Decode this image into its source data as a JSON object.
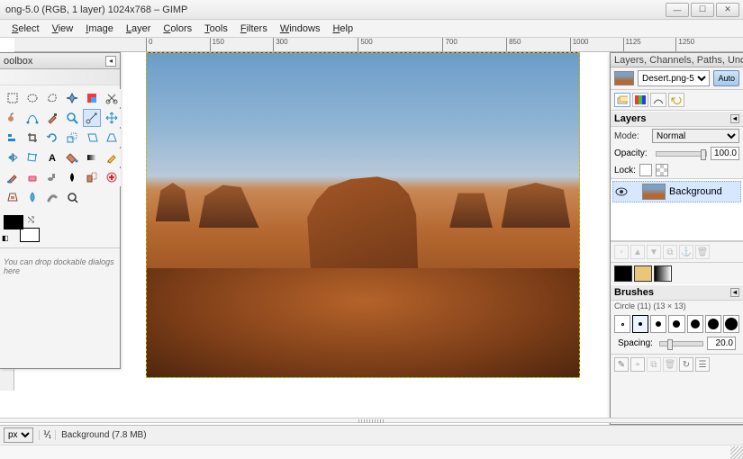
{
  "title": "ong-5.0 (RGB, 1 layer) 1024x768 – GIMP",
  "menu": [
    "Select",
    "View",
    "Image",
    "Layer",
    "Colors",
    "Tools",
    "Filters",
    "Windows",
    "Help"
  ],
  "ruler_ticks": [
    0,
    150,
    300,
    500,
    700,
    850,
    1000,
    1125,
    1250
  ],
  "toolbox": {
    "title": "oolbox",
    "drop_hint": "You can drop dockable dialogs here",
    "tools": [
      "rect-select",
      "ellipse-select",
      "free-select",
      "fuzzy-select",
      "by-color-select",
      "scissors",
      "foreground-select",
      "paths",
      "color-picker",
      "zoom",
      "measure",
      "move",
      "align",
      "crop",
      "rotate",
      "scale",
      "shear",
      "perspective",
      "flip",
      "cage",
      "text",
      "bucket-fill",
      "blend",
      "pencil",
      "paintbrush",
      "eraser",
      "airbrush",
      "ink",
      "clone",
      "heal",
      "perspective-clone",
      "blur",
      "smudge",
      "dodge"
    ],
    "active_tool": "measure"
  },
  "dock": {
    "title": "Layers, Channels, Paths, Undo - B…",
    "image_selector": "Desert.png-5",
    "auto_label": "Auto",
    "tabs": [
      "layers",
      "channels",
      "paths",
      "undo"
    ],
    "layers_panel": {
      "heading": "Layers",
      "mode_label": "Mode:",
      "mode_value": "Normal",
      "opacity_label": "Opacity:",
      "opacity_value": "100.0",
      "lock_label": "Lock:",
      "layers": [
        {
          "name": "Background",
          "visible": true
        }
      ]
    },
    "swatches": [
      "#000000",
      "#e8c878",
      "#888888"
    ],
    "brushes_panel": {
      "heading": "Brushes",
      "subtitle": "Circle (11) (13 × 13)",
      "sizes": [
        2,
        4,
        6,
        8,
        10,
        12,
        14
      ],
      "selected": 1,
      "spacing_label": "Spacing:",
      "spacing_value": "20.0"
    }
  },
  "status": {
    "unit": "px",
    "zoom": "⅟₁",
    "text": "Background (7.8 MB)"
  }
}
